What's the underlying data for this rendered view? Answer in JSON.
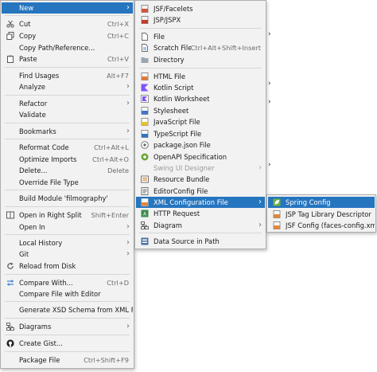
{
  "context_menu": {
    "new": "New",
    "cut": "Cut",
    "cut_sc": "Ctrl+X",
    "copy": "Copy",
    "copy_sc": "Ctrl+C",
    "copy_path": "Copy Path/Reference...",
    "paste": "Paste",
    "paste_sc": "Ctrl+V",
    "find_usages": "Find Usages",
    "find_usages_sc": "Alt+F7",
    "analyze": "Analyze",
    "refactor": "Refactor",
    "validate": "Validate",
    "bookmarks": "Bookmarks",
    "reformat": "Reformat Code",
    "reformat_sc": "Ctrl+Alt+L",
    "optimize": "Optimize Imports",
    "optimize_sc": "Ctrl+Alt+O",
    "delete": "Delete...",
    "delete_sc": "Delete",
    "override_type": "Override File Type",
    "build_module": "Build Module 'filmography'",
    "open_split": "Open in Right Split",
    "open_split_sc": "Shift+Enter",
    "open_in": "Open In",
    "local_history": "Local History",
    "git": "Git",
    "reload": "Reload from Disk",
    "compare_with": "Compare With...",
    "compare_with_sc": "Ctrl+D",
    "compare_editor": "Compare File with Editor",
    "gen_xsd": "Generate XSD Schema from XML File...",
    "diagrams": "Diagrams",
    "create_gist": "Create Gist...",
    "package_file": "Package File",
    "package_file_sc": "Ctrl+Shift+F9"
  },
  "new_menu": {
    "jsf_facelets": "JSF/Facelets",
    "jsp_jspx": "JSP/JSPX",
    "file": "File",
    "scratch": "Scratch File",
    "scratch_sc": "Ctrl+Alt+Shift+Insert",
    "directory": "Directory",
    "html": "HTML File",
    "kotlin_script": "Kotlin Script",
    "kotlin_worksheet": "Kotlin Worksheet",
    "stylesheet": "Stylesheet",
    "javascript": "JavaScript File",
    "typescript": "TypeScript File",
    "package_json": "package.json File",
    "openapi": "OpenAPI Specification",
    "swing": "Swing UI Designer",
    "resource_bundle": "Resource Bundle",
    "editorconfig": "EditorConfig File",
    "xml_config": "XML Configuration File",
    "http_request": "HTTP Request",
    "diagram": "Diagram",
    "data_source": "Data Source in Path"
  },
  "xml_menu": {
    "spring": "Spring Config",
    "jsp_tag": "JSP Tag Library Descriptor",
    "jsf_config": "JSF Config (faces-config.xml)"
  }
}
